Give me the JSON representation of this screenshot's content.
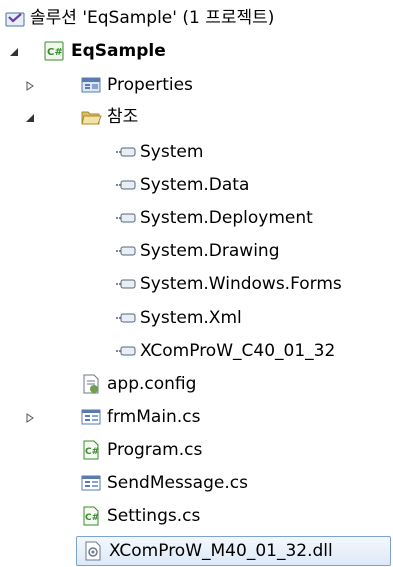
{
  "tree": {
    "solution_label": "솔루션 'EqSample' (1 프로젝트)",
    "project_label": "EqSample",
    "properties_label": "Properties",
    "references_label": "참조",
    "references": [
      "System",
      "System.Data",
      "System.Deployment",
      "System.Drawing",
      "System.Windows.Forms",
      "System.Xml",
      "XComProW_C40_01_32"
    ],
    "files": [
      "app.config",
      "frmMain.cs",
      "Program.cs",
      "SendMessage.cs",
      "Settings.cs",
      "XComProW_M40_01_32.dll"
    ]
  },
  "colors": {
    "selection_border": "#7da2ce",
    "csharp_icon": "#3a8a2e",
    "folder": "#e8c96a"
  }
}
